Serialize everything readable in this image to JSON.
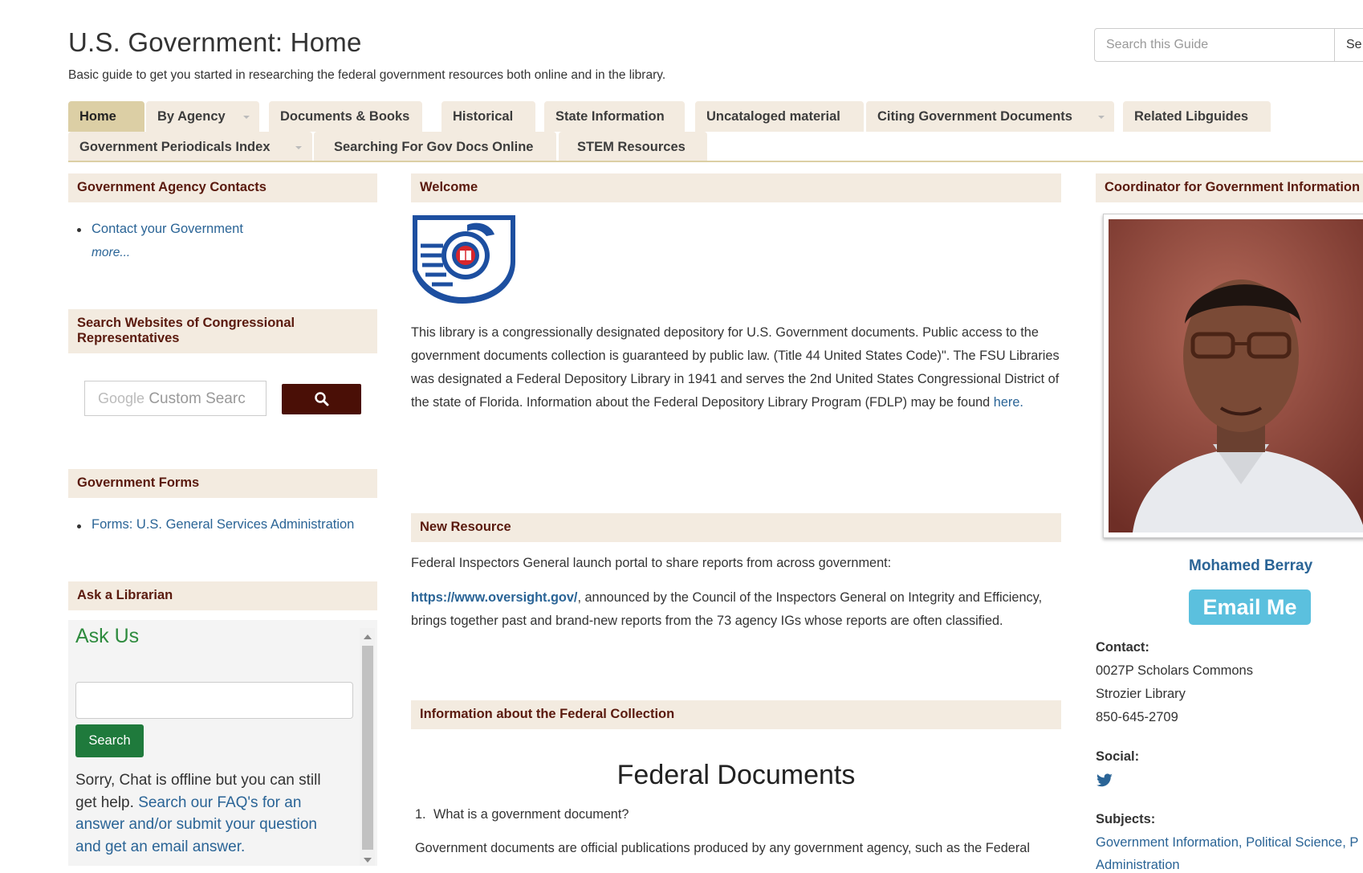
{
  "header": {
    "title": "U.S. Government: Home",
    "description": "Basic guide to get you started in researching the federal government resources both online and in the library.",
    "search_placeholder": "Search this Guide",
    "search_button": "Se"
  },
  "tabs": [
    {
      "label": "Home",
      "active": true
    },
    {
      "label": "By Agency",
      "dropdown": true
    },
    {
      "label": "Documents & Books"
    },
    {
      "label": "Historical"
    },
    {
      "label": "State Information"
    },
    {
      "label": "Uncataloged material"
    },
    {
      "label": "Citing Government Documents",
      "dropdown": true
    },
    {
      "label": "Related Libguides"
    },
    {
      "label": "Government Periodicals Index",
      "dropdown": true
    },
    {
      "label": "Searching For Gov Docs Online"
    },
    {
      "label": "STEM Resources"
    }
  ],
  "left": {
    "agency_contacts": {
      "heading": "Government Agency Contacts",
      "link": "Contact your Government",
      "more": "more..."
    },
    "congress_search": {
      "heading": "Search Websites of Congressional Representatives",
      "placeholder_brand": "Google",
      "placeholder": "Custom Searc"
    },
    "forms": {
      "heading": "Government Forms",
      "link": "Forms: U.S. General Services Administration"
    },
    "ask": {
      "heading": "Ask a Librarian",
      "title": "Ask Us",
      "search_button": "Search",
      "offline_text": "Sorry, Chat is offline but you can still get help.",
      "faq_link": "Search our FAQ's for an answer and/or submit your question and get an email answer."
    }
  },
  "center": {
    "welcome": {
      "heading": "Welcome",
      "text": "This library is a congressionally designated depository for U.S. Government documents. Public access to the government documents collection is guaranteed by public law. (Title 44 United States Code)\". The FSU Libraries was designated a Federal Depository Library in 1941 and serves the 2nd United States Congressional District of the state of Florida. Information about the Federal Depository Library Program (FDLP) may be found",
      "link": "here."
    },
    "new_resource": {
      "heading": "New Resource",
      "intro": "Federal Inspectors General launch portal to share reports from across government:",
      "url": "https://www.oversight.gov/",
      "text": ", announced by the Council of the Inspectors General on Integrity and Efficiency, brings together past and brand-new reports from the 73 agency IGs whose reports are often classified."
    },
    "federal_collection": {
      "heading": "Information about the Federal Collection",
      "title": "Federal Documents",
      "q1_num": "1.",
      "q1": "What is a government document?",
      "p1": "Government documents are official publications produced by any government agency, such as the Federal"
    }
  },
  "right": {
    "heading": "Coordinator for Government Information",
    "name": "Mohamed Berray",
    "email_button": "Email Me",
    "contact_label": "Contact:",
    "contact_lines": [
      "0027P Scholars Commons",
      "Strozier Library",
      "850-645-2709"
    ],
    "social_label": "Social:",
    "subjects_label": "Subjects:",
    "subjects": "Government Information, Political Science, P",
    "subjects_line2": "Administration"
  },
  "colors": {
    "tab_bg": "#f3ebe0",
    "tab_active": "#dccfa5",
    "heading_text": "#5a1a0e",
    "link": "#2a6496",
    "ask_green": "#2e8b3e",
    "email_btn": "#5bc0de"
  }
}
